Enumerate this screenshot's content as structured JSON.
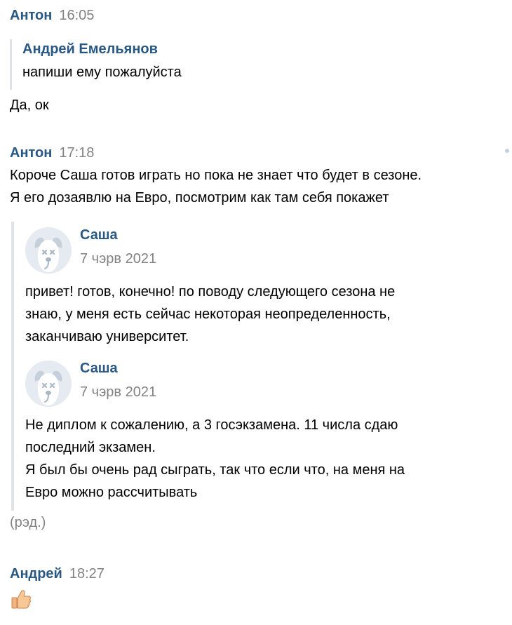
{
  "messages": [
    {
      "author": "Антон",
      "time": "16:05",
      "quote": {
        "author": "Андрей Емельянов",
        "text": "напиши ему пожалуйста"
      },
      "text": "Да, ок"
    },
    {
      "author": "Антон",
      "time": "17:18",
      "lines": [
        "Короче Саша готов играть но пока не знает что будет в сезоне.",
        "Я его дозаявлю на Евро, посмотрим как там себя покажет"
      ],
      "forwarded": [
        {
          "author": "Саша",
          "date": "7 чэрв 2021",
          "lines": [
            "привет! готов, конечно! по поводу следующего сезона не",
            "знаю, у меня есть сейчас некоторая неопределенность,",
            "заканчиваю университет."
          ]
        },
        {
          "author": "Саша",
          "date": "7 чэрв 2021",
          "lines": [
            "Не диплом к сожалению, а 3 госэкзамена. 11 числа сдаю",
            "последний экзамен.",
            "Я был бы очень рад сыграть, так что если что, на меня на",
            "Евро можно рассчитывать"
          ]
        }
      ],
      "edited": "(рэд.)"
    },
    {
      "author": "Андрей",
      "time": "18:27",
      "emoji": "thumbs-up-icon"
    }
  ],
  "colors": {
    "author": "#2a5885",
    "time": "#828282",
    "quote_border": "#dfe3e8",
    "avatar_bg": "#e5ebf1"
  }
}
